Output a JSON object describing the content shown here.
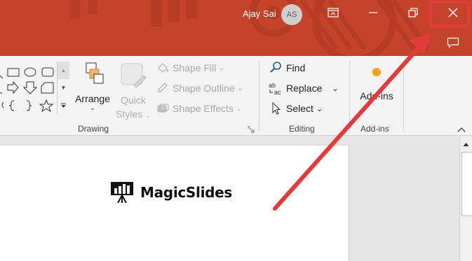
{
  "titlebar": {
    "user_name": "Ajay Sai",
    "avatar_initials": "AS",
    "brand_color": "#c4432a"
  },
  "ribbon": {
    "drawing": {
      "arrange_label": "Arrange",
      "quick_styles_line1": "Quick",
      "quick_styles_line2": "Styles",
      "shape_fill": "Shape Fill",
      "shape_outline": "Shape Outline",
      "shape_effects": "Shape Effects",
      "group_label": "Drawing"
    },
    "editing": {
      "find": "Find",
      "replace": "Replace",
      "select": "Select",
      "group_label": "Editing"
    },
    "addins": {
      "button_label": "Add-ins",
      "group_label": "Add-ins"
    }
  },
  "slide": {
    "logo_text": "MagicSlides"
  },
  "annotation": {
    "color": "#e33b3b"
  }
}
